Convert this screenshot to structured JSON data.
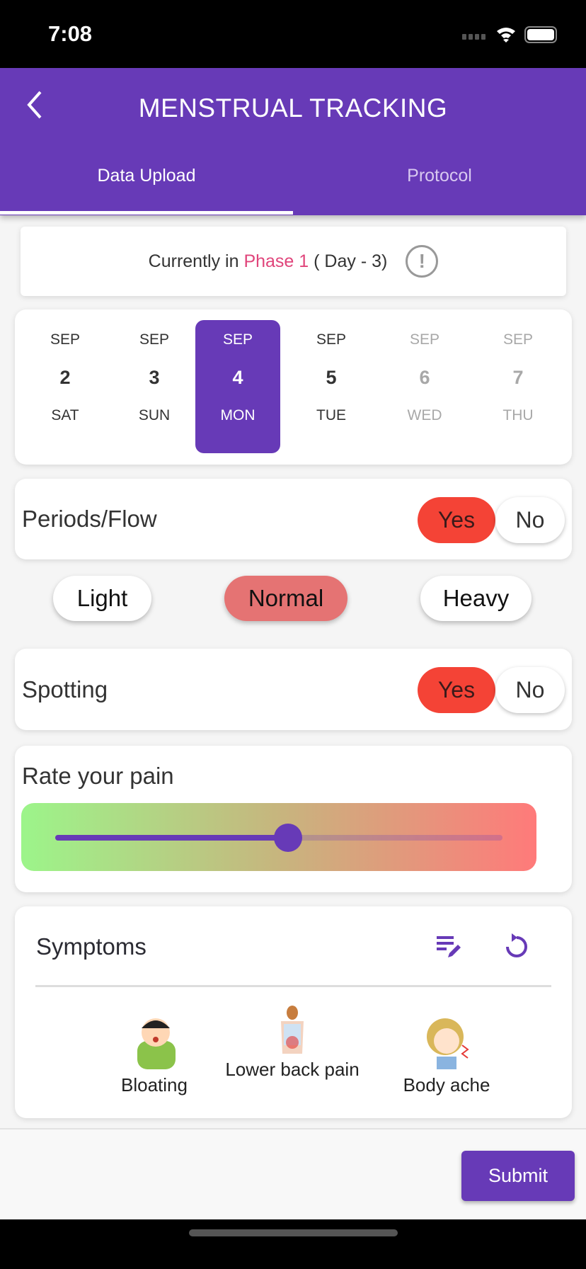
{
  "status_bar": {
    "time": "7:08"
  },
  "header": {
    "title": "MENSTRUAL TRACKING",
    "back_icon": "chevron-left-icon"
  },
  "tabs": [
    {
      "label": "Data Upload",
      "active": true
    },
    {
      "label": "Protocol",
      "active": false
    }
  ],
  "phase": {
    "prefix": "Currently in",
    "phase": "Phase 1",
    "day": "( Day - 3)",
    "info_glyph": "!",
    "phase_color": "#e0457b"
  },
  "calendar": [
    {
      "month": "SEP",
      "day": "2",
      "weekday": "SAT",
      "state": "normal"
    },
    {
      "month": "SEP",
      "day": "3",
      "weekday": "SUN",
      "state": "normal"
    },
    {
      "month": "SEP",
      "day": "4",
      "weekday": "MON",
      "state": "selected"
    },
    {
      "month": "SEP",
      "day": "5",
      "weekday": "TUE",
      "state": "normal"
    },
    {
      "month": "SEP",
      "day": "6",
      "weekday": "WED",
      "state": "disabled"
    },
    {
      "month": "SEP",
      "day": "7",
      "weekday": "THU",
      "state": "disabled"
    }
  ],
  "periods": {
    "label": "Periods/Flow",
    "yes": "Yes",
    "no": "No",
    "selected": "Yes"
  },
  "flow": {
    "options": [
      "Light",
      "Normal",
      "Heavy"
    ],
    "selected": "Normal"
  },
  "spotting": {
    "label": "Spotting",
    "yes": "Yes",
    "no": "No",
    "selected": "Yes"
  },
  "pain": {
    "label": "Rate your pain",
    "value_fraction": 0.52
  },
  "symptoms": {
    "title": "Symptoms",
    "edit_icon": "edit-list-icon",
    "reset_icon": "refresh-icon",
    "items": [
      {
        "label": "Bloating"
      },
      {
        "label": "Lower back pain"
      },
      {
        "label": "Body ache"
      }
    ]
  },
  "submit": "Submit",
  "colors": {
    "primary": "#673ab7",
    "yes": "#f44336",
    "selected_flow": "#e57373"
  }
}
